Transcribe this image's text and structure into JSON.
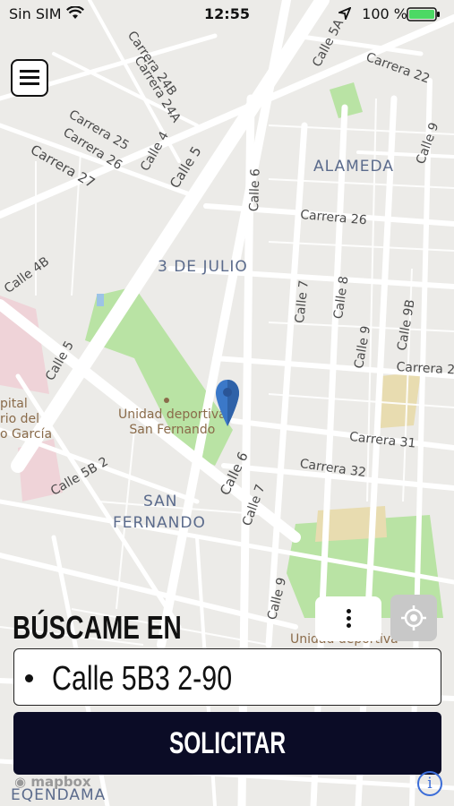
{
  "status_bar": {
    "carrier": "Sin SIM",
    "time": "12:55",
    "battery": "100 %"
  },
  "map": {
    "neighborhoods": [
      "ALAMEDA",
      "3 DE JULIO",
      "SAN",
      "FERNANDO"
    ],
    "streets": [
      "Carrera 24A",
      "Carrera 24B",
      "Carrera 25",
      "Carrera 26",
      "Carrera 27",
      "Calle 4",
      "Calle 5",
      "Calle 6",
      "Calle 7",
      "Calle 8",
      "Calle 9",
      "Calle 9B",
      "Carrera 26",
      "Carrera 2",
      "Carrera 31",
      "Carrera 32",
      "Calle 5B 2",
      "Calle 4B",
      "Calle 5A",
      "Carrera 22",
      "Calle 9",
      "Calle 5"
    ],
    "poi": [
      "Unidad deportiva",
      "San Fernando"
    ],
    "poi_left": [
      "pital",
      "rio del",
      "o García"
    ],
    "poi_bottom": "Unidad deportiva",
    "bottom_label": "EQENDAMA",
    "attribution": "mapbox"
  },
  "sheet": {
    "headline": "BÚSCAME EN",
    "address": "Calle 5B3 2-90",
    "button": "SOLICITAR"
  },
  "icons": {
    "menu": "hamburger-icon",
    "more": "more-vertical-icon",
    "locate": "crosshair-icon",
    "pin": "map-pin-icon",
    "info": "info-icon"
  },
  "colors": {
    "button_bg": "#0b0c26",
    "pin": "#3b78c8",
    "park": "#b9e3a4"
  }
}
